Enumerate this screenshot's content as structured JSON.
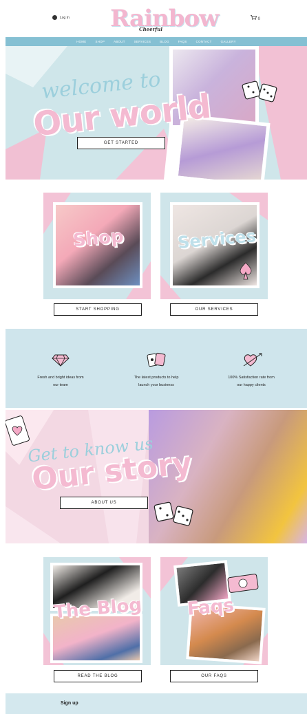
{
  "header": {
    "login_label": "Log In",
    "logo_text": "Rainbow",
    "logo_tagline": "Cheerful",
    "cart_count": "0"
  },
  "nav": {
    "items": [
      "HOME",
      "SHOP",
      "ABOUT",
      "SERVICES",
      "BLOG",
      "FAQS",
      "CONTACT",
      "GALLERY"
    ]
  },
  "hero": {
    "script_text": "welcome to",
    "headline": "Our world",
    "button_label": "GET STARTED"
  },
  "cards": {
    "shop_title": "Shop",
    "services_title": "Services",
    "shop_button": "START SHOPPING",
    "services_button": "OUR SERVICES"
  },
  "features": [
    {
      "icon": "diamond-icon",
      "line1": "Fresh and bright ideas from",
      "line2": "our team"
    },
    {
      "icon": "cards-icon",
      "line1": "The latest products to help",
      "line2": "launch your business"
    },
    {
      "icon": "heart-arrow-icon",
      "line1": "100% Satisfaction rate from",
      "line2": "our happy clients"
    }
  ],
  "story": {
    "script_text": "Get to know us",
    "headline": "Our story",
    "button_label": "ABOUT US"
  },
  "bottom_cards": {
    "blog_title": "The Blog",
    "faqs_title": "Faqs",
    "blog_button": "READ THE BLOG",
    "faqs_button": "OUR FAQS"
  },
  "signup": {
    "title": "Sign up"
  },
  "colors": {
    "pink": "#f4bad1",
    "light_blue": "#cfe6ea",
    "nav_blue": "#85c0d3",
    "script_blue": "#9ccfdc"
  }
}
